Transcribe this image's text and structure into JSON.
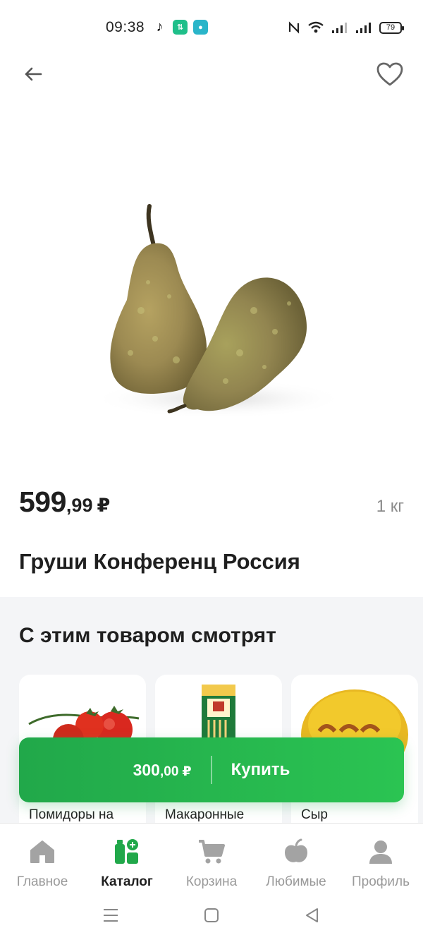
{
  "status_bar": {
    "time": "09:38",
    "battery": "79"
  },
  "product": {
    "price_int": "599",
    "price_frac": ",99",
    "currency": "₽",
    "unit": "1 кг",
    "title": "Груши Конференц Россия"
  },
  "related": {
    "title": "С этим товаром смотрят",
    "items": [
      {
        "name": "Помидоры на"
      },
      {
        "name": "Макаронные"
      },
      {
        "name": "Сыр"
      }
    ]
  },
  "buy_bar": {
    "total_int": "300",
    "total_frac": ",00",
    "currency": "₽",
    "label": "Купить"
  },
  "bottom_nav": {
    "items": [
      {
        "label": "Главное",
        "icon": "home-icon",
        "active": false
      },
      {
        "label": "Каталог",
        "icon": "catalog-icon",
        "active": true
      },
      {
        "label": "Корзина",
        "icon": "cart-icon",
        "active": false
      },
      {
        "label": "Любимые",
        "icon": "apple-icon",
        "active": false
      },
      {
        "label": "Профиль",
        "icon": "profile-icon",
        "active": false
      }
    ]
  },
  "colors": {
    "accent": "#21a84a",
    "nav_inactive": "#9a9a9a",
    "section_bg": "#f4f5f7"
  }
}
